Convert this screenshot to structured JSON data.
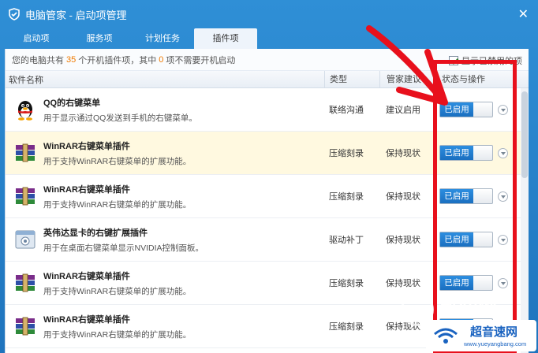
{
  "window": {
    "title": "电脑管家 - 启动项管理"
  },
  "tabs": [
    {
      "label": "启动项"
    },
    {
      "label": "服务项"
    },
    {
      "label": "计划任务"
    },
    {
      "label": "插件项"
    }
  ],
  "info": {
    "prefix": "您的电脑共有",
    "total": "35",
    "middle": "个开机插件项，其中",
    "unneeded": "0",
    "suffix": "项不需要开机启动",
    "show_disabled_label": "显示已禁用的项"
  },
  "columns": {
    "name": "软件名称",
    "type": "类型",
    "advice": "管家建议",
    "status": "状态与操作"
  },
  "rows": [
    {
      "name": "QQ的右键菜单",
      "desc": "用于显示通过QQ发送到手机的右键菜单。",
      "type": "联络沟通",
      "advice": "建议启用",
      "status": "已启用",
      "icon": "qq-penguin-icon"
    },
    {
      "name": "WinRAR右键菜单插件",
      "desc": "用于支持WinRAR右键菜单的扩展功能。",
      "type": "压缩刻录",
      "advice": "保持现状",
      "status": "已启用",
      "icon": "winrar-icon"
    },
    {
      "name": "WinRAR右键菜单插件",
      "desc": "用于支持WinRAR右键菜单的扩展功能。",
      "type": "压缩刻录",
      "advice": "保持现状",
      "status": "已启用",
      "icon": "winrar-icon"
    },
    {
      "name": "英伟达显卡的右键扩展插件",
      "desc": "用于在桌面右键菜单显示NVIDIA控制面板。",
      "type": "驱动补丁",
      "advice": "保持现状",
      "status": "已启用",
      "icon": "nvidia-panel-icon"
    },
    {
      "name": "WinRAR右键菜单插件",
      "desc": "用于支持WinRAR右键菜单的扩展功能。",
      "type": "压缩刻录",
      "advice": "保持现状",
      "status": "已启用",
      "icon": "winrar-icon"
    },
    {
      "name": "WinRAR右键菜单插件",
      "desc": "用于支持WinRAR右键菜单的扩展功能。",
      "type": "压缩刻录",
      "advice": "保持现状",
      "status": "已启用",
      "icon": "winrar-icon"
    }
  ],
  "watermark": {
    "text1": "酷知网",
    "text2": "超音速网",
    "text3": "www.yueyangbang.com"
  },
  "colors": {
    "accent": "#1a6fc0",
    "annotation": "#e8101c",
    "highlight_row": "#fff9e0",
    "count_orange": "#f07a00"
  }
}
